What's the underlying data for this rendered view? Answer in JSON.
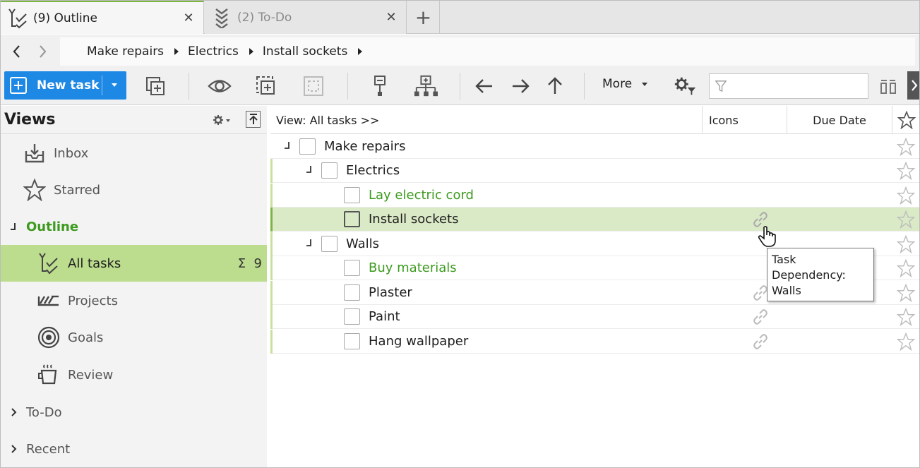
{
  "tabs": [
    {
      "label": "(9) Outline",
      "active": true,
      "icon": "checklist-icon"
    },
    {
      "label": "(2) To-Do",
      "active": false,
      "icon": "chevron-stack-icon"
    }
  ],
  "breadcrumb": [
    "Make repairs",
    "Electrics",
    "Install sockets"
  ],
  "toolbar": {
    "new_task_label": "New task",
    "more_label": "More",
    "filter_placeholder": "",
    "accent_color": "#1e88e5"
  },
  "views": {
    "title": "Views",
    "items": [
      {
        "label": "Inbox",
        "icon": "inbox-icon"
      },
      {
        "label": "Starred",
        "icon": "star-icon"
      },
      {
        "label": "Outline",
        "icon": "collapse-icon",
        "section": true
      },
      {
        "label": "All tasks",
        "icon": "checklist-icon",
        "selected": true,
        "count_symbol": "Σ",
        "count": "9"
      },
      {
        "label": "Projects",
        "icon": "projects-icon"
      },
      {
        "label": "Goals",
        "icon": "target-icon"
      },
      {
        "label": "Review",
        "icon": "coffee-icon"
      },
      {
        "label": "To-Do",
        "icon": "chevron-right-icon",
        "section": true
      },
      {
        "label": "Recent",
        "icon": "chevron-right-icon",
        "section": true
      }
    ]
  },
  "grid": {
    "view_label": "View: All tasks >>",
    "columns": [
      "Icons",
      "Due Date"
    ],
    "rows": [
      {
        "title": "Make repairs",
        "level": 0,
        "collapsible": true,
        "green": false,
        "link": false
      },
      {
        "title": "Electrics",
        "level": 1,
        "collapsible": true,
        "green": false,
        "link": false
      },
      {
        "title": "Lay electric cord",
        "level": 2,
        "collapsible": false,
        "green": true,
        "link": false
      },
      {
        "title": "Install sockets",
        "level": 2,
        "collapsible": false,
        "green": false,
        "link": true,
        "selected": true
      },
      {
        "title": "Walls",
        "level": 1,
        "collapsible": true,
        "green": false,
        "link": false
      },
      {
        "title": "Buy materials",
        "level": 2,
        "collapsible": false,
        "green": true,
        "link": false
      },
      {
        "title": "Plaster",
        "level": 2,
        "collapsible": false,
        "green": false,
        "link": true
      },
      {
        "title": "Paint",
        "level": 2,
        "collapsible": false,
        "green": false,
        "link": true
      },
      {
        "title": "Hang wallpaper",
        "level": 2,
        "collapsible": false,
        "green": false,
        "link": true
      }
    ]
  },
  "tooltip": {
    "line1": "Task Dependency:",
    "line2": "Walls"
  }
}
